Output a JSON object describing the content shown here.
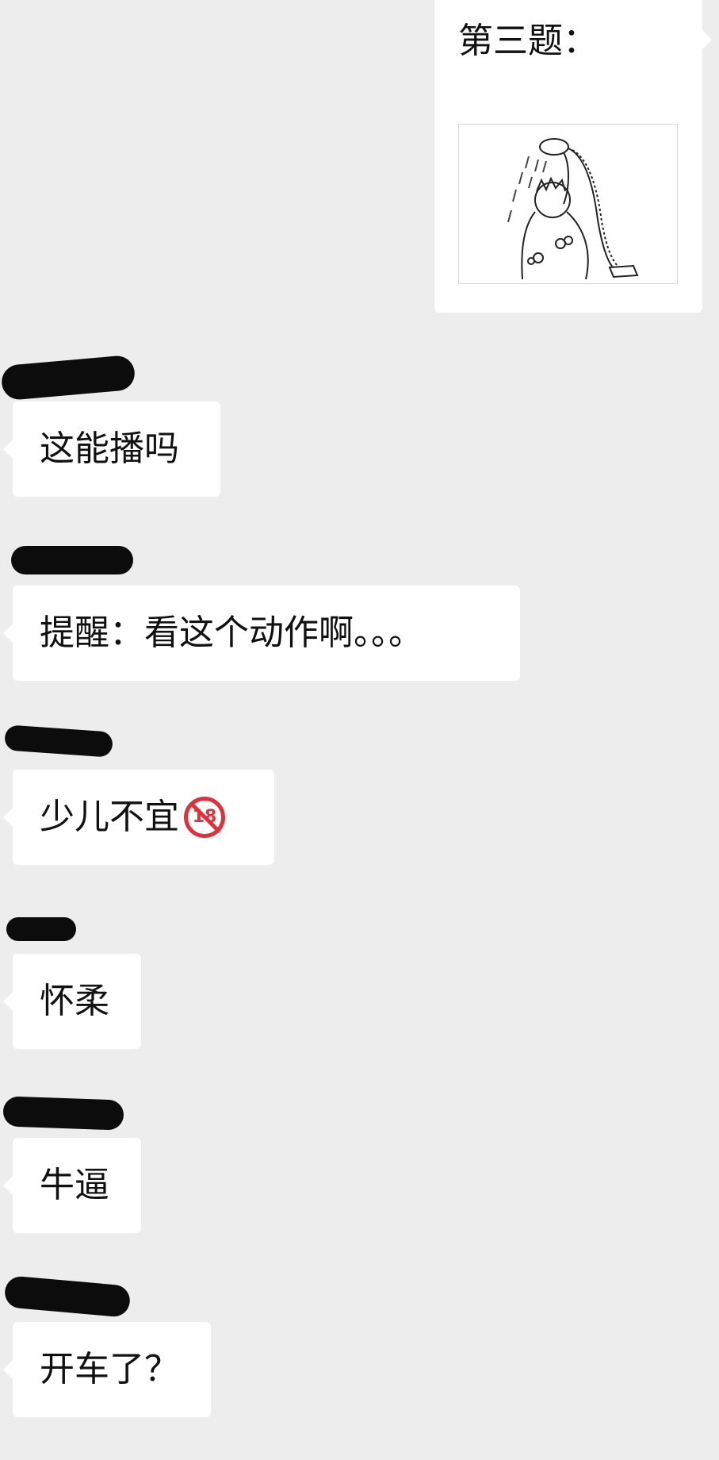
{
  "messages": {
    "q3": {
      "title": "第三题：",
      "image": "shower-cartoon"
    },
    "m1": {
      "text": "这能播吗"
    },
    "m2": {
      "text": "提醒：看这个动作啊。。。"
    },
    "m3": {
      "text": "少儿不宜",
      "emoji": "🔞"
    },
    "m4": {
      "text": "怀柔"
    },
    "m5": {
      "text": "牛逼"
    },
    "m6": {
      "text": "开车了？"
    }
  }
}
